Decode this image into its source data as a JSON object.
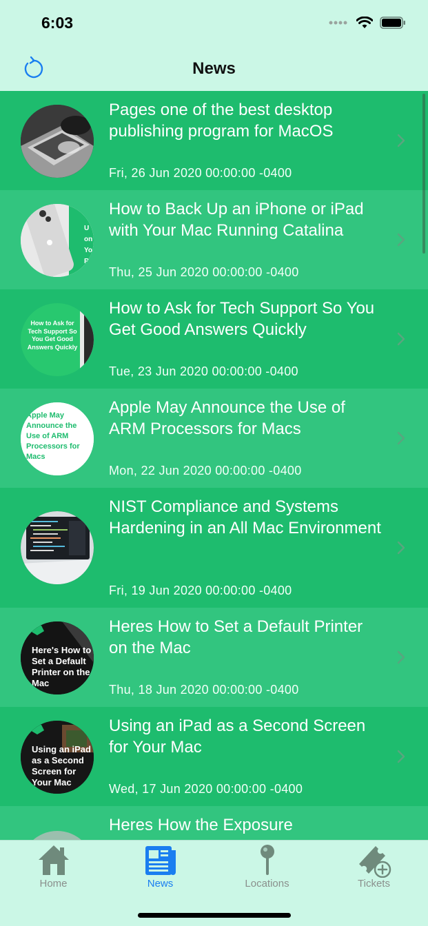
{
  "status_bar": {
    "time": "6:03"
  },
  "nav": {
    "title": "News"
  },
  "news": [
    {
      "title": "Pages one of the best desktop publishing program for MacOS",
      "date": "Fri, 26 Jun 2020 00:00:00 -0400"
    },
    {
      "title": "How to Back Up an iPhone or iPad with Your Mac Running Catalina",
      "date": "Thu, 25 Jun 2020 00:00:00 -0400"
    },
    {
      "title": "How to Ask for Tech Support So You Get Good Answers Quickly",
      "date": "Tue, 23 Jun 2020 00:00:00 -0400",
      "thumb_text": "How to Ask for Tech Support So You Get Good Answers Quickly"
    },
    {
      "title": "Apple May Announce the Use of ARM Processors for Macs",
      "date": "Mon, 22 Jun 2020 00:00:00 -0400",
      "thumb_text": "Apple May Announce the Use of ARM Processors for Macs"
    },
    {
      "title": "NIST Compliance and Systems Hardening in an All Mac Environment",
      "date": "Fri, 19 Jun 2020 00:00:00 -0400"
    },
    {
      "title": "Heres How to Set a Default Printer on the Mac",
      "date": "Thu, 18 Jun 2020 00:00:00 -0400",
      "thumb_text": "Here's How to Set a Default Printer on the Mac"
    },
    {
      "title": "Using an iPad as a Second Screen for Your Mac",
      "date": "Wed, 17 Jun 2020 00:00:00 -0400",
      "thumb_text": "Using an iPad as a Second Screen for Your Mac"
    },
    {
      "title": "Heres How the Exposure",
      "date": ""
    }
  ],
  "tabs": [
    {
      "label": "Home",
      "icon": "home-icon"
    },
    {
      "label": "News",
      "icon": "newspaper-icon",
      "active": true
    },
    {
      "label": "Locations",
      "icon": "map-pin-icon"
    },
    {
      "label": "Tickets",
      "icon": "ticket-add-icon"
    }
  ],
  "colors": {
    "background": "#cbf7e6",
    "row_dark": "#1ebc6e",
    "row_light": "#32c57f",
    "accent": "#1a7ef0",
    "tab_inactive": "#8a8f8c"
  }
}
